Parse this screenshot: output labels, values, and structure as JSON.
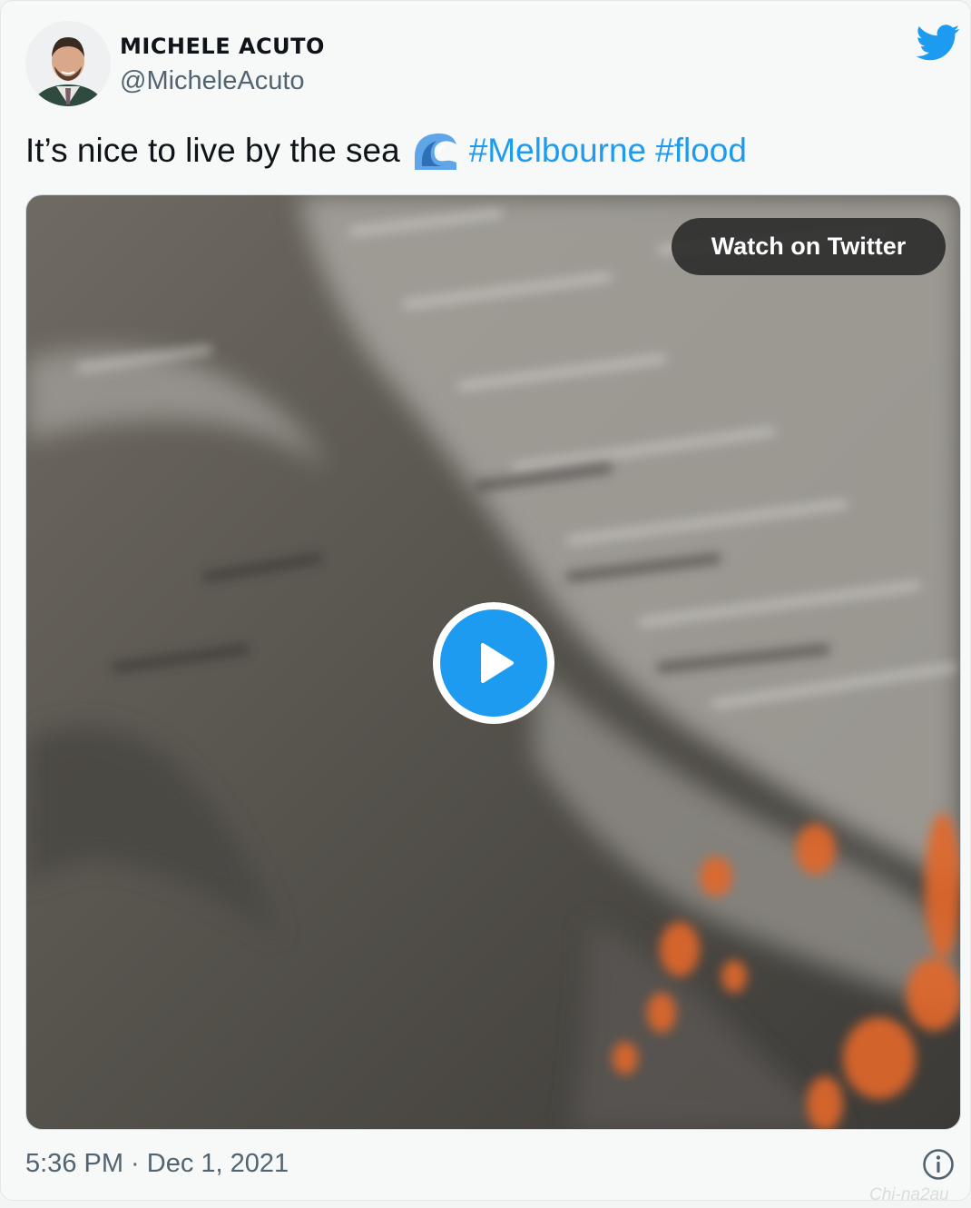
{
  "author": {
    "name": "MICHELE ACUTO",
    "handle": "@MicheleAcuto"
  },
  "icons": {
    "logo": "twitter-bird-icon",
    "emoji": "water-wave-emoji",
    "info": "info-icon",
    "play": "play-icon"
  },
  "tweet": {
    "text": "It’s nice to live by the sea",
    "hashtags": [
      "#Melbourne",
      "#flood"
    ]
  },
  "media": {
    "watch_label": "Watch on Twitter"
  },
  "timestamp": "5:36 PM · Dec 1, 2021",
  "watermark": "Chi-na2au",
  "colors": {
    "accent": "#1d9bf0",
    "muted_text": "#536471",
    "text": "#0f1419"
  }
}
